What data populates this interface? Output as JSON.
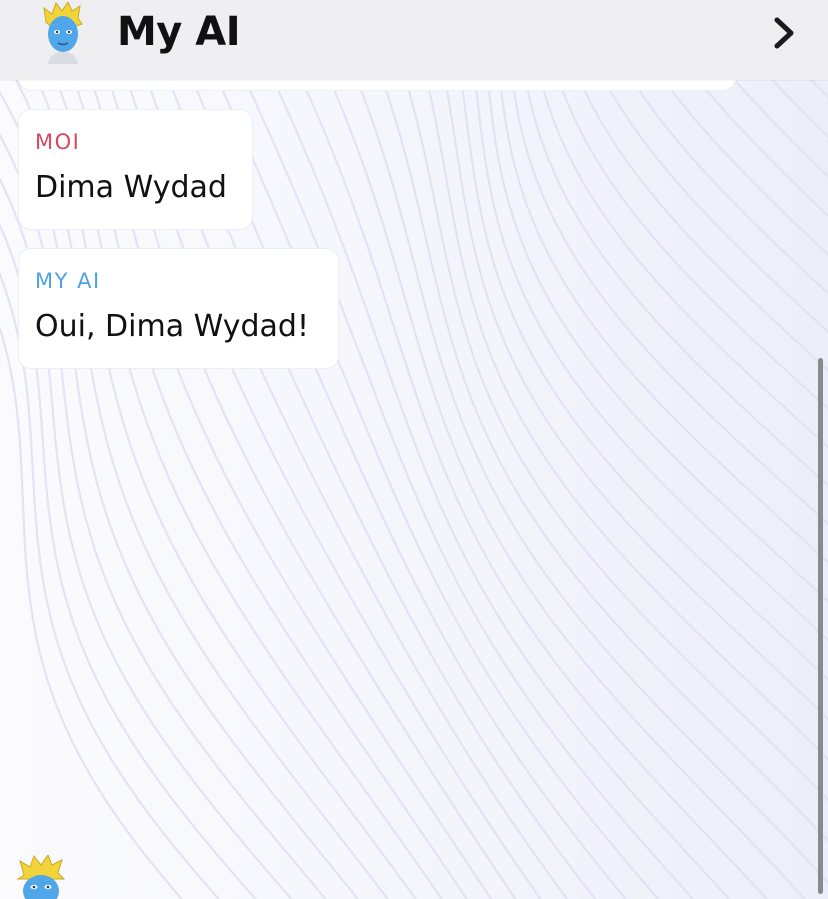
{
  "header": {
    "title": "My AI",
    "avatar_icon": "bitmoji-avatar-icon",
    "forward_icon": "chevron-right-icon"
  },
  "messages": [
    {
      "sender": "MOI",
      "text": "Dima Wydad",
      "sender_color": "#d64a5f"
    },
    {
      "sender": "MY AI",
      "text": "Oui, Dima Wydad!",
      "sender_color": "#4ea3e3"
    }
  ],
  "footer": {
    "avatar_icon": "bitmoji-avatar-icon"
  },
  "colors": {
    "header_bg": "#efeff1",
    "background": "#f7f8fd",
    "wave_shade": "#dfe2f4"
  }
}
